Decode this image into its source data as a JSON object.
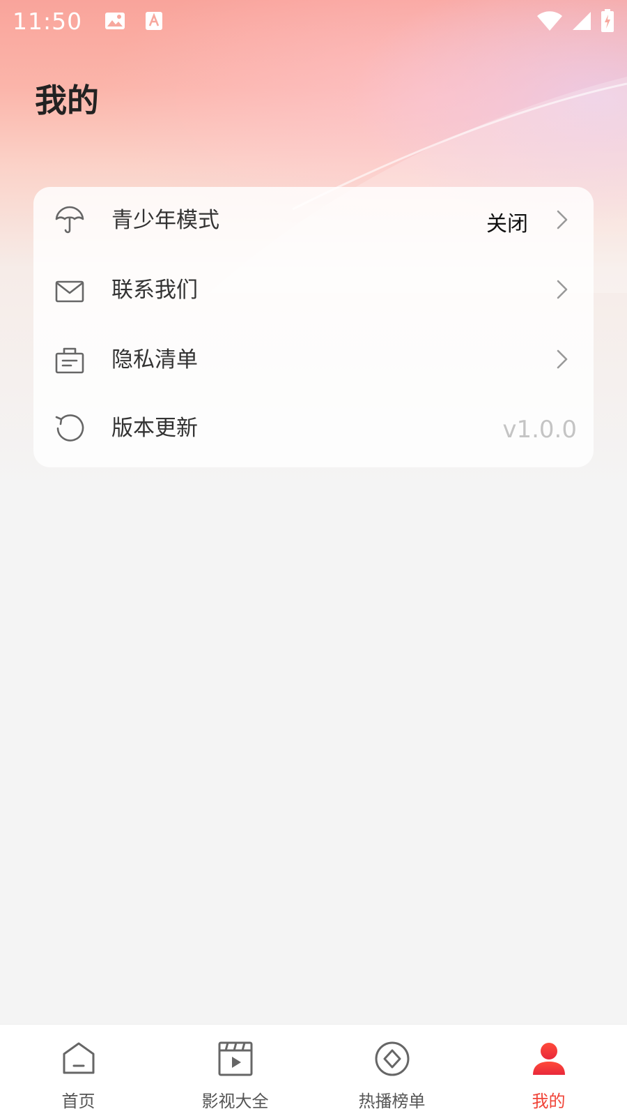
{
  "status_bar": {
    "time": "11:50",
    "icons": [
      "image-icon",
      "text-a-icon",
      "wifi-icon",
      "signal-icon",
      "battery-charging-icon"
    ]
  },
  "page": {
    "title": "我的"
  },
  "menu": {
    "items": [
      {
        "icon": "umbrella-icon",
        "label": "青少年模式",
        "value": "关闭",
        "has_chevron": true
      },
      {
        "icon": "mail-icon",
        "label": "联系我们",
        "value": "",
        "has_chevron": true
      },
      {
        "icon": "privacy-list-icon",
        "label": "隐私清单",
        "value": "",
        "has_chevron": true
      },
      {
        "icon": "refresh-icon",
        "label": "版本更新",
        "value": "v1.0.0",
        "has_chevron": false
      }
    ]
  },
  "tabbar": {
    "tabs": [
      {
        "icon": "home-icon",
        "label": "首页",
        "active": false
      },
      {
        "icon": "video-icon",
        "label": "影视大全",
        "active": false
      },
      {
        "icon": "compass-icon",
        "label": "热播榜单",
        "active": false
      },
      {
        "icon": "user-icon",
        "label": "我的",
        "active": true
      }
    ]
  },
  "colors": {
    "accent": "#f04438",
    "text_primary": "#222222",
    "text_secondary": "#333333",
    "value_muted": "#c4c4c4",
    "icon_gray": "#666666"
  }
}
